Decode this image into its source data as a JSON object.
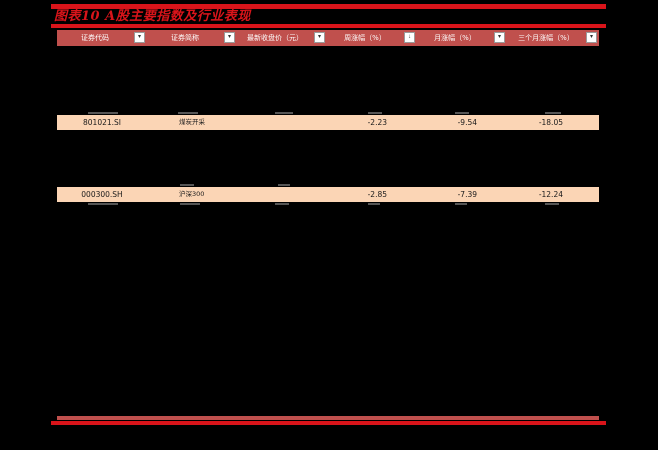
{
  "report": {
    "title": "图表10  A股主要指数及行业表现"
  },
  "table": {
    "columns": [
      {
        "label": "证券代码",
        "filter_icon": "▾"
      },
      {
        "label": "证券简称",
        "filter_icon": "▾"
      },
      {
        "label": "最新收盘价（元）",
        "filter_icon": "▾"
      },
      {
        "label": "周涨幅（%）",
        "filter_icon": "↓"
      },
      {
        "label": "月涨幅（%）",
        "filter_icon": "▾"
      },
      {
        "label": "三个月涨幅（%）",
        "filter_icon": "▾"
      }
    ],
    "rows": [
      {
        "code": "801021.SI",
        "name": "煤炭开采",
        "close": "",
        "week": "-2.23",
        "month": "-9.54",
        "three_month": "-18.05"
      },
      {
        "code": "000300.SH",
        "name": "沪深300",
        "close": "",
        "week": "-2.85",
        "month": "-7.39",
        "three_month": "-12.24"
      }
    ]
  },
  "colors": {
    "accent_red": "#d9141a",
    "header_bg": "#c0504d",
    "highlight_row": "#fbd5b5",
    "background": "#000000"
  }
}
